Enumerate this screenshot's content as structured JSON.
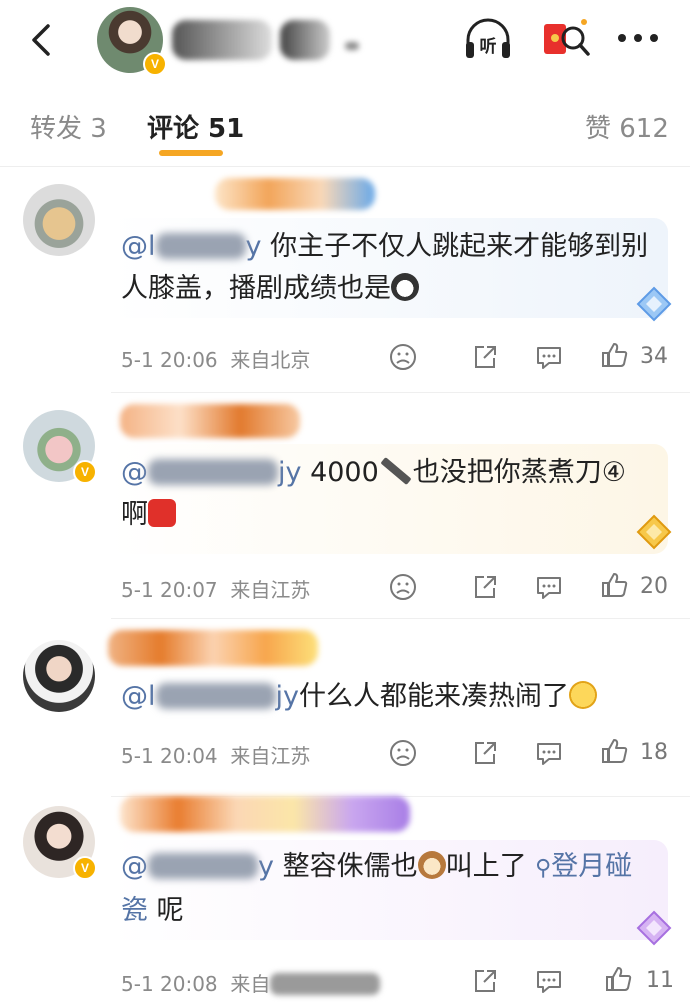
{
  "header": {
    "listen_label": "听"
  },
  "tabs": {
    "repost": "转发 3",
    "comments": "评论 51",
    "likes": "赞 612"
  },
  "comments": [
    {
      "mention": "@l",
      "mention_tail": "y",
      "text": "你主子不仅人跳起来才能够到别人膝盖，播剧成绩也是",
      "time": "5-1 20:06",
      "location": "来自北京",
      "likes": "34"
    },
    {
      "mention": "@",
      "mention_tail": "jy",
      "text_a": "4000",
      "text_b": "也没把你蒸煮刀④啊",
      "time": "5-1 20:07",
      "location": "来自江苏",
      "likes": "20"
    },
    {
      "mention": "@l",
      "mention_tail": "jy",
      "text": "什么人都能来凑热闹了",
      "time": "5-1 20:04",
      "location": "来自江苏",
      "likes": "18"
    },
    {
      "mention": "@",
      "mention_tail": "y",
      "text_a": "整容侏儒也",
      "text_b": "叫上了",
      "search_text": "登月碰瓷",
      "text_c": " 呢",
      "time": "5-1 20:08",
      "location": "来自",
      "likes": "11"
    }
  ],
  "colors": {
    "accent": "#f5a623",
    "mention": "#5574a6",
    "meta": "#8a8a8a",
    "verified": "#f7b200"
  }
}
